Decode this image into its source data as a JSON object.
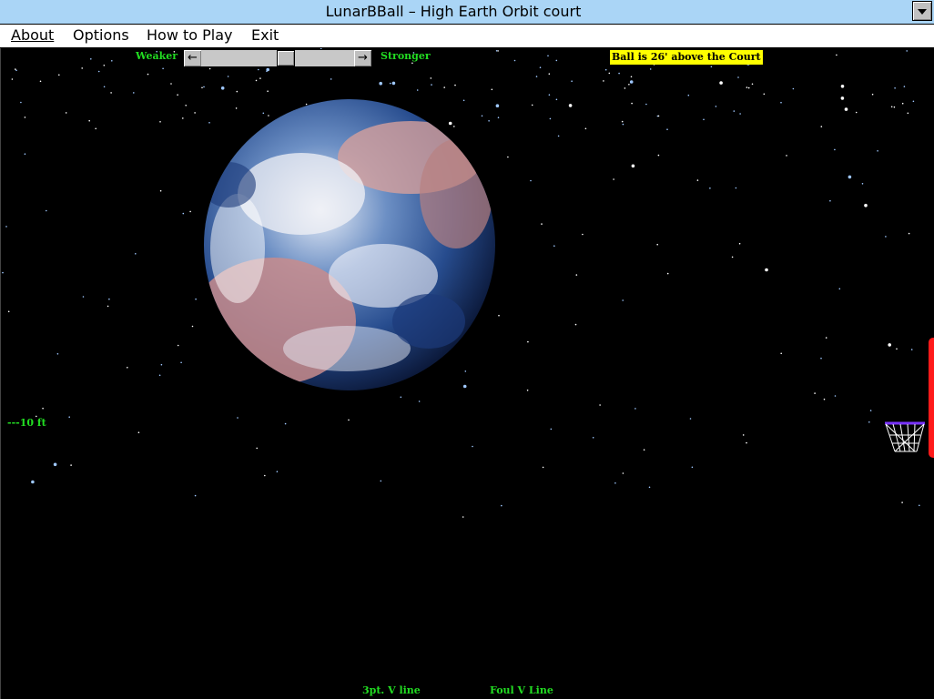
{
  "window": {
    "title": "LunarBBall – High Earth Orbit court"
  },
  "menu": {
    "items": [
      {
        "key": "about",
        "label": "About"
      },
      {
        "key": "options",
        "label": "Options"
      },
      {
        "key": "howtoplay",
        "label": "How to Play"
      },
      {
        "key": "exit",
        "label": "Exit"
      }
    ]
  },
  "strength": {
    "weaker_label": "Weaker",
    "stronger_label": "Stronger",
    "left_arrow": "←",
    "right_arrow": "→",
    "level": 0.5
  },
  "status": {
    "text": "Ball is  26' above the Court"
  },
  "court": {
    "height_marker": "---10 ft",
    "three_pt_label": "3pt. V line",
    "foul_label": "Foul V Line"
  },
  "icons": {
    "earth": "earth-icon",
    "hoop": "basketball-hoop-icon",
    "backboard": "backboard-icon"
  },
  "colors": {
    "titlebar": "#aad5f6",
    "label_green": "#22dd22",
    "status_bg": "#ffff00",
    "backboard": "#ff1a1a",
    "rim": "#7a33ff"
  }
}
